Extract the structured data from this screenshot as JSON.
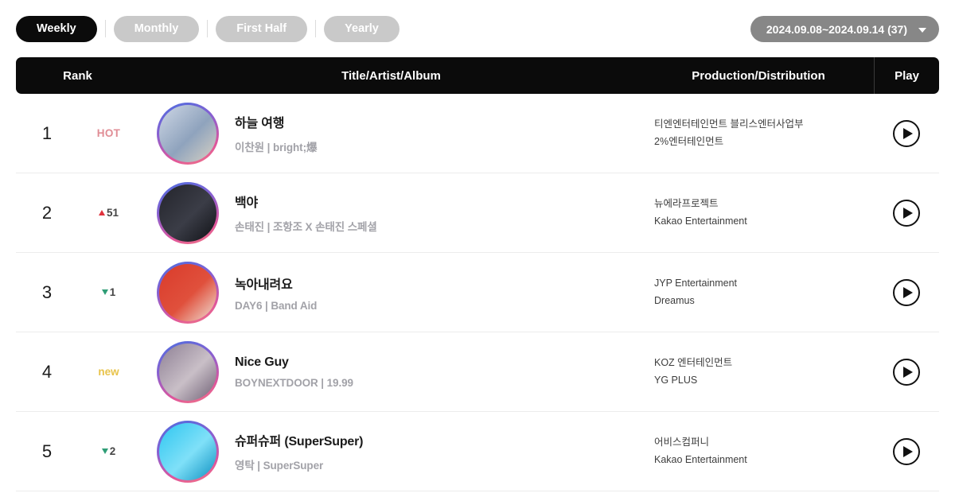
{
  "tabs": [
    {
      "label": "Weekly",
      "active": true
    },
    {
      "label": "Monthly",
      "active": false
    },
    {
      "label": "First Half",
      "active": false
    },
    {
      "label": "Yearly",
      "active": false
    }
  ],
  "date_selector": {
    "label": "2024.09.08~2024.09.14 (37)",
    "icon": "chevron-down-icon"
  },
  "table": {
    "headers": {
      "rank": "Rank",
      "title": "Title/Artist/Album",
      "production": "Production/Distribution",
      "play": "Play"
    },
    "rows": [
      {
        "rank": "1",
        "change_type": "hot",
        "change_label": "HOT",
        "title": "하늘 여행",
        "subtitle": "이찬원 | bright;爆",
        "production": "티엔엔터테인먼트 블리스엔터사업부",
        "distribution": "2%엔터테인먼트",
        "art_colors": [
          "#cfd8e6",
          "#8fa3bd",
          "#d8d2c4"
        ],
        "play_label": "Play"
      },
      {
        "rank": "2",
        "change_type": "up",
        "change_label": "51",
        "title": "백야",
        "subtitle": "손태진 | 조항조 X 손태진 스페셜",
        "production": "뉴에라프로젝트",
        "distribution": "Kakao Entertainment",
        "art_colors": [
          "#23242b",
          "#3b3d47",
          "#101116"
        ],
        "play_label": "Play"
      },
      {
        "rank": "3",
        "change_type": "down",
        "change_label": "1",
        "title": "녹아내려요",
        "subtitle": "DAY6 | Band Aid",
        "production": "JYP Entertainment",
        "distribution": "Dreamus",
        "art_colors": [
          "#d93b2b",
          "#e0503c",
          "#f0e2d8"
        ],
        "play_label": "Play"
      },
      {
        "rank": "4",
        "change_type": "new",
        "change_label": "new",
        "title": "Nice Guy",
        "subtitle": "BOYNEXTDOOR | 19.99",
        "production": "KOZ 엔터테인먼트",
        "distribution": "YG PLUS",
        "art_colors": [
          "#8d7f94",
          "#c9bfc7",
          "#6e5f74"
        ],
        "play_label": "Play"
      },
      {
        "rank": "5",
        "change_type": "down",
        "change_label": "2",
        "title": "슈퍼슈퍼 (SuperSuper)",
        "subtitle": "영탁 | SuperSuper",
        "production": "어비스컴퍼니",
        "distribution": "Kakao Entertainment",
        "art_colors": [
          "#2ec6f0",
          "#7fe0f8",
          "#0c8fc0"
        ],
        "play_label": "Play"
      }
    ]
  },
  "colors": {
    "accent_hot": "#e08d95",
    "accent_new": "#e8c34a",
    "arrow_up": "#e0323c",
    "arrow_down": "#2f9d76",
    "header_bg": "#0b0b0b",
    "tab_inactive": "#c9c9c9",
    "date_pill": "#878787"
  }
}
